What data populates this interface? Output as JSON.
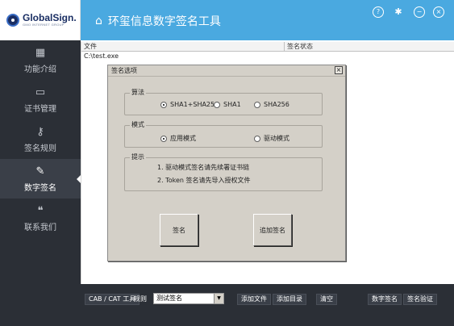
{
  "brand": {
    "name": "GlobalSign.",
    "tagline": "GMO INTERNET GROUP"
  },
  "header": {
    "title": "环玺信息数字签名工具",
    "help_glyph": "?",
    "settings_glyph": "✱",
    "minimize_glyph": "−",
    "close_glyph": "×"
  },
  "sidebar": {
    "items": [
      {
        "label": "功能介绍",
        "icon": "grid-icon",
        "glyph": "▦"
      },
      {
        "label": "证书管理",
        "icon": "folder-icon",
        "glyph": "▭"
      },
      {
        "label": "签名规则",
        "icon": "key-icon",
        "glyph": "⚷"
      },
      {
        "label": "数字签名",
        "icon": "pencil-icon",
        "glyph": "✎"
      },
      {
        "label": "联系我们",
        "icon": "chat-icon",
        "glyph": "❝"
      }
    ]
  },
  "file_list": {
    "columns": [
      "文件",
      "签名状态"
    ],
    "rows": [
      "C:\\test.exe"
    ]
  },
  "dialog": {
    "title": "签名选项",
    "close_glyph": "×",
    "algorithm": {
      "title": "算法",
      "options": [
        "SHA1+SHA256",
        "SHA1",
        "SHA256"
      ],
      "selected": "SHA1+SHA256"
    },
    "mode": {
      "title": "模式",
      "options": [
        "应用模式",
        "驱动模式"
      ],
      "selected": "应用模式"
    },
    "tips": {
      "title": "提示",
      "lines": [
        "1. 驱动模式签名请先续署证书链",
        "2. Token 签名请先导入授权文件"
      ]
    },
    "sign_button": "签名",
    "append_sign_button": "追加签名"
  },
  "toolbar": {
    "cab_cat_button": "CAB / CAT 工具",
    "rule_label": "规则",
    "rule_value": "测试签名",
    "add_file_button": "添加文件",
    "add_folder_button": "添加目录",
    "clear_button": "清空",
    "digital_sign_button": "数字签名",
    "verify_button": "签名验证"
  },
  "colors": {
    "header_blue": "#4aa9e0",
    "sidebar_dark": "#2b2f36",
    "dialog_gray": "#d4d0c8"
  }
}
